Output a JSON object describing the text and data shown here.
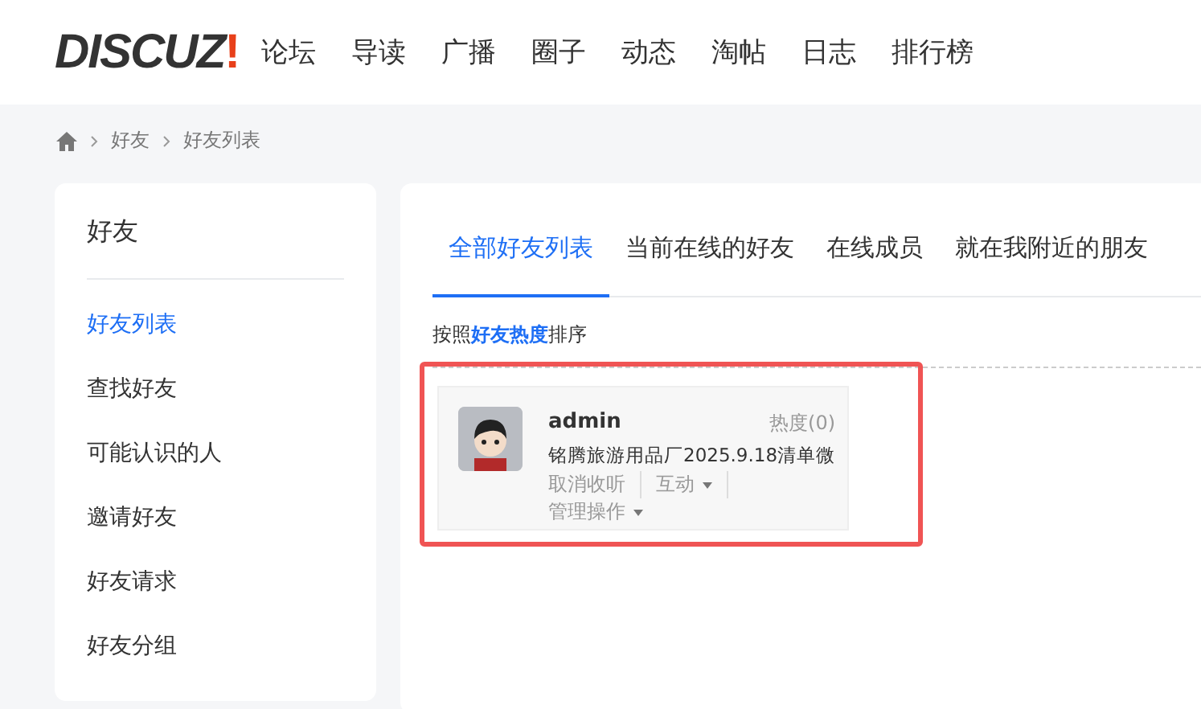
{
  "header": {
    "logo": "DISCUZ",
    "logo_mark": "!",
    "nav": [
      "论坛",
      "导读",
      "广播",
      "圈子",
      "动态",
      "淘帖",
      "日志",
      "排行榜"
    ]
  },
  "breadcrumb": [
    "好友",
    "好友列表"
  ],
  "sidebar": {
    "title": "好友",
    "items": [
      {
        "label": "好友列表",
        "selected": true
      },
      {
        "label": "查找好友",
        "selected": false
      },
      {
        "label": "可能认识的人",
        "selected": false
      },
      {
        "label": "邀请好友",
        "selected": false
      },
      {
        "label": "好友请求",
        "selected": false
      },
      {
        "label": "好友分组",
        "selected": false
      }
    ]
  },
  "tabs": [
    {
      "label": "全部好友列表",
      "selected": true
    },
    {
      "label": "当前在线的好友",
      "selected": false
    },
    {
      "label": "在线成员",
      "selected": false
    },
    {
      "label": "就在我附近的朋友",
      "selected": false
    }
  ],
  "sort_label": "按照**好友热度**排序",
  "friends": [
    {
      "name": "admin",
      "heat": "热度(0)",
      "note": "铭腾旅游用品厂2025.9.18清单微",
      "actions": [
        {
          "label": "取消收听",
          "dropdown": false
        },
        {
          "label": "互动",
          "dropdown": true
        },
        {
          "label": "管理操作",
          "dropdown": true
        }
      ]
    }
  ]
}
